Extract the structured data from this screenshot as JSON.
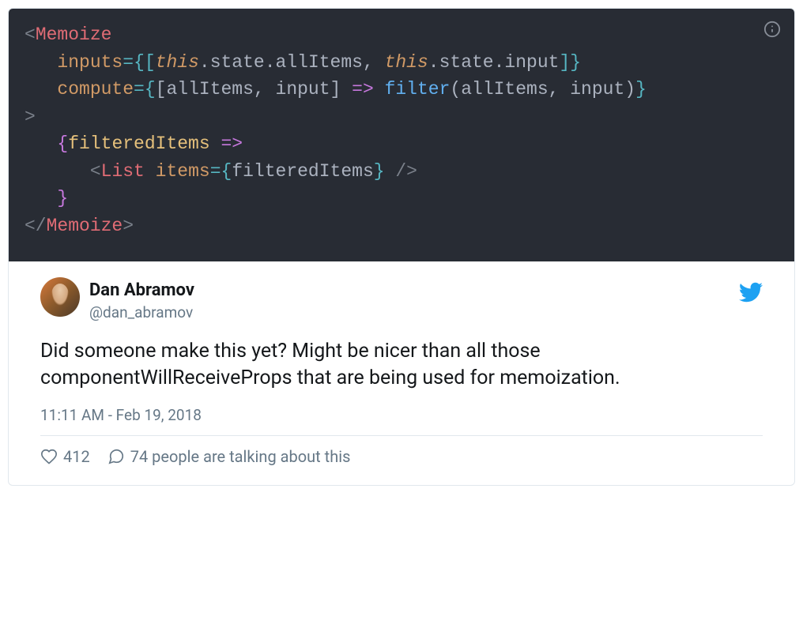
{
  "code": {
    "line1": {
      "open": "<",
      "tag": "Memoize"
    },
    "line2": {
      "indent": "   ",
      "attr": "inputs",
      "eq": "=",
      "lb": "{[",
      "this1": "this",
      "dot1": ".",
      "p1": "state",
      "dot2": ".",
      "p2": "allItems",
      "comma": ", ",
      "this2": "this",
      "dot3": ".",
      "p3": "state",
      "dot4": ".",
      "p4": "input",
      "rb": "]}"
    },
    "line3": {
      "indent": "   ",
      "attr": "compute",
      "eq": "=",
      "lb": "{",
      "lbr": "[",
      "arg1": "allItems",
      "comma": ", ",
      "arg2": "input",
      "rbr": "]",
      "sp": " ",
      "arrow": "=>",
      "sp2": " ",
      "fn": "filter",
      "lp": "(",
      "a1": "allItems",
      "comma2": ", ",
      "a2": "input",
      "rp": ")",
      "rb": "}"
    },
    "line4": {
      "close": ">"
    },
    "line5": {
      "indent": "   ",
      "lb": "{",
      "var": "filteredItems",
      "sp": " ",
      "arrow": "=>"
    },
    "line6": {
      "indent": "      ",
      "open": "<",
      "tag": "List",
      "sp": " ",
      "attr": "items",
      "eq": "=",
      "lb": "{",
      "var": "filteredItems",
      "rb": "}",
      "sp2": " ",
      "close": "/>"
    },
    "line7": {
      "indent": "   ",
      "rb": "}"
    },
    "line8": {
      "open": "</",
      "tag": "Memoize",
      "close": ">"
    }
  },
  "tweet": {
    "author_name": "Dan Abramov",
    "author_handle": "@dan_abramov",
    "text": "Did someone make this yet? Might be nicer than all those componentWillReceiveProps that are being used for memoization.",
    "time": "11:11 AM - Feb 19, 2018",
    "likes": "412",
    "replies_text": "74 people are talking about this"
  }
}
